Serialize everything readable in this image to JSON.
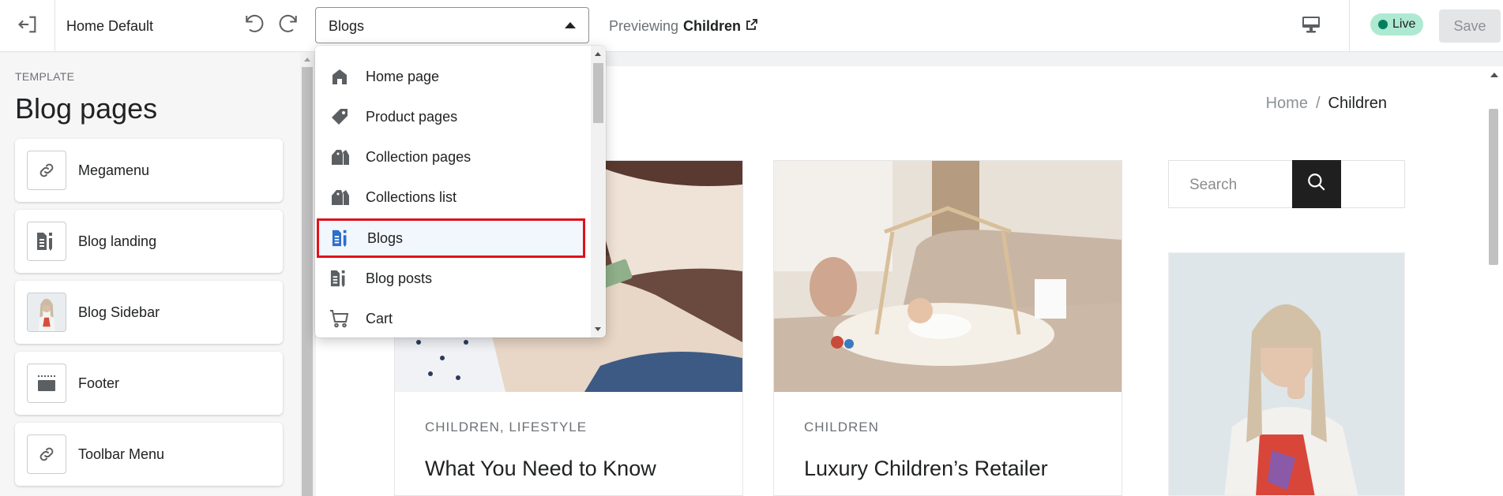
{
  "topbar": {
    "exit_icon": "exit-icon",
    "theme_name": "Home Default",
    "undo_icon": "undo-icon",
    "redo_icon": "redo-icon",
    "template_select_value": "Blogs",
    "previewing_label": "Previewing",
    "previewing_target": "Children",
    "external_icon": "external-link-icon",
    "device_icon": "desktop-icon",
    "live_label": "Live",
    "save_label": "Save"
  },
  "sidebar": {
    "eyebrow": "TEMPLATE",
    "title": "Blog pages",
    "items": [
      {
        "label": "Megamenu",
        "icon": "link-icon"
      },
      {
        "label": "Blog landing",
        "icon": "blog-icon"
      },
      {
        "label": "Blog Sidebar",
        "icon": "image-thumbnail"
      },
      {
        "label": "Footer",
        "icon": "footer-icon"
      },
      {
        "label": "Toolbar Menu",
        "icon": "link-icon"
      }
    ]
  },
  "dropdown": {
    "items": [
      {
        "label": "Home page",
        "icon": "home-icon"
      },
      {
        "label": "Product pages",
        "icon": "tag-icon"
      },
      {
        "label": "Collection pages",
        "icon": "collection-icon"
      },
      {
        "label": "Collections list",
        "icon": "collection-icon"
      },
      {
        "label": "Blogs",
        "icon": "blog-icon",
        "selected": true
      },
      {
        "label": "Blog posts",
        "icon": "blog-icon"
      },
      {
        "label": "Cart",
        "icon": "cart-icon"
      }
    ]
  },
  "preview": {
    "breadcrumb": {
      "home": "Home",
      "separator": "/",
      "current": "Children"
    },
    "search_placeholder": "Search",
    "posts": [
      {
        "tags": "CHILDREN,  LIFESTYLE",
        "title": "What You Need to Know"
      },
      {
        "tags": "CHILDREN",
        "title": "Luxury Children’s Retailer"
      }
    ]
  },
  "colors": {
    "accent_selected": "#2c6ecb",
    "selection_outline": "#e0121b",
    "live_badge": "#aee9d1",
    "live_dot": "#007f5f"
  }
}
